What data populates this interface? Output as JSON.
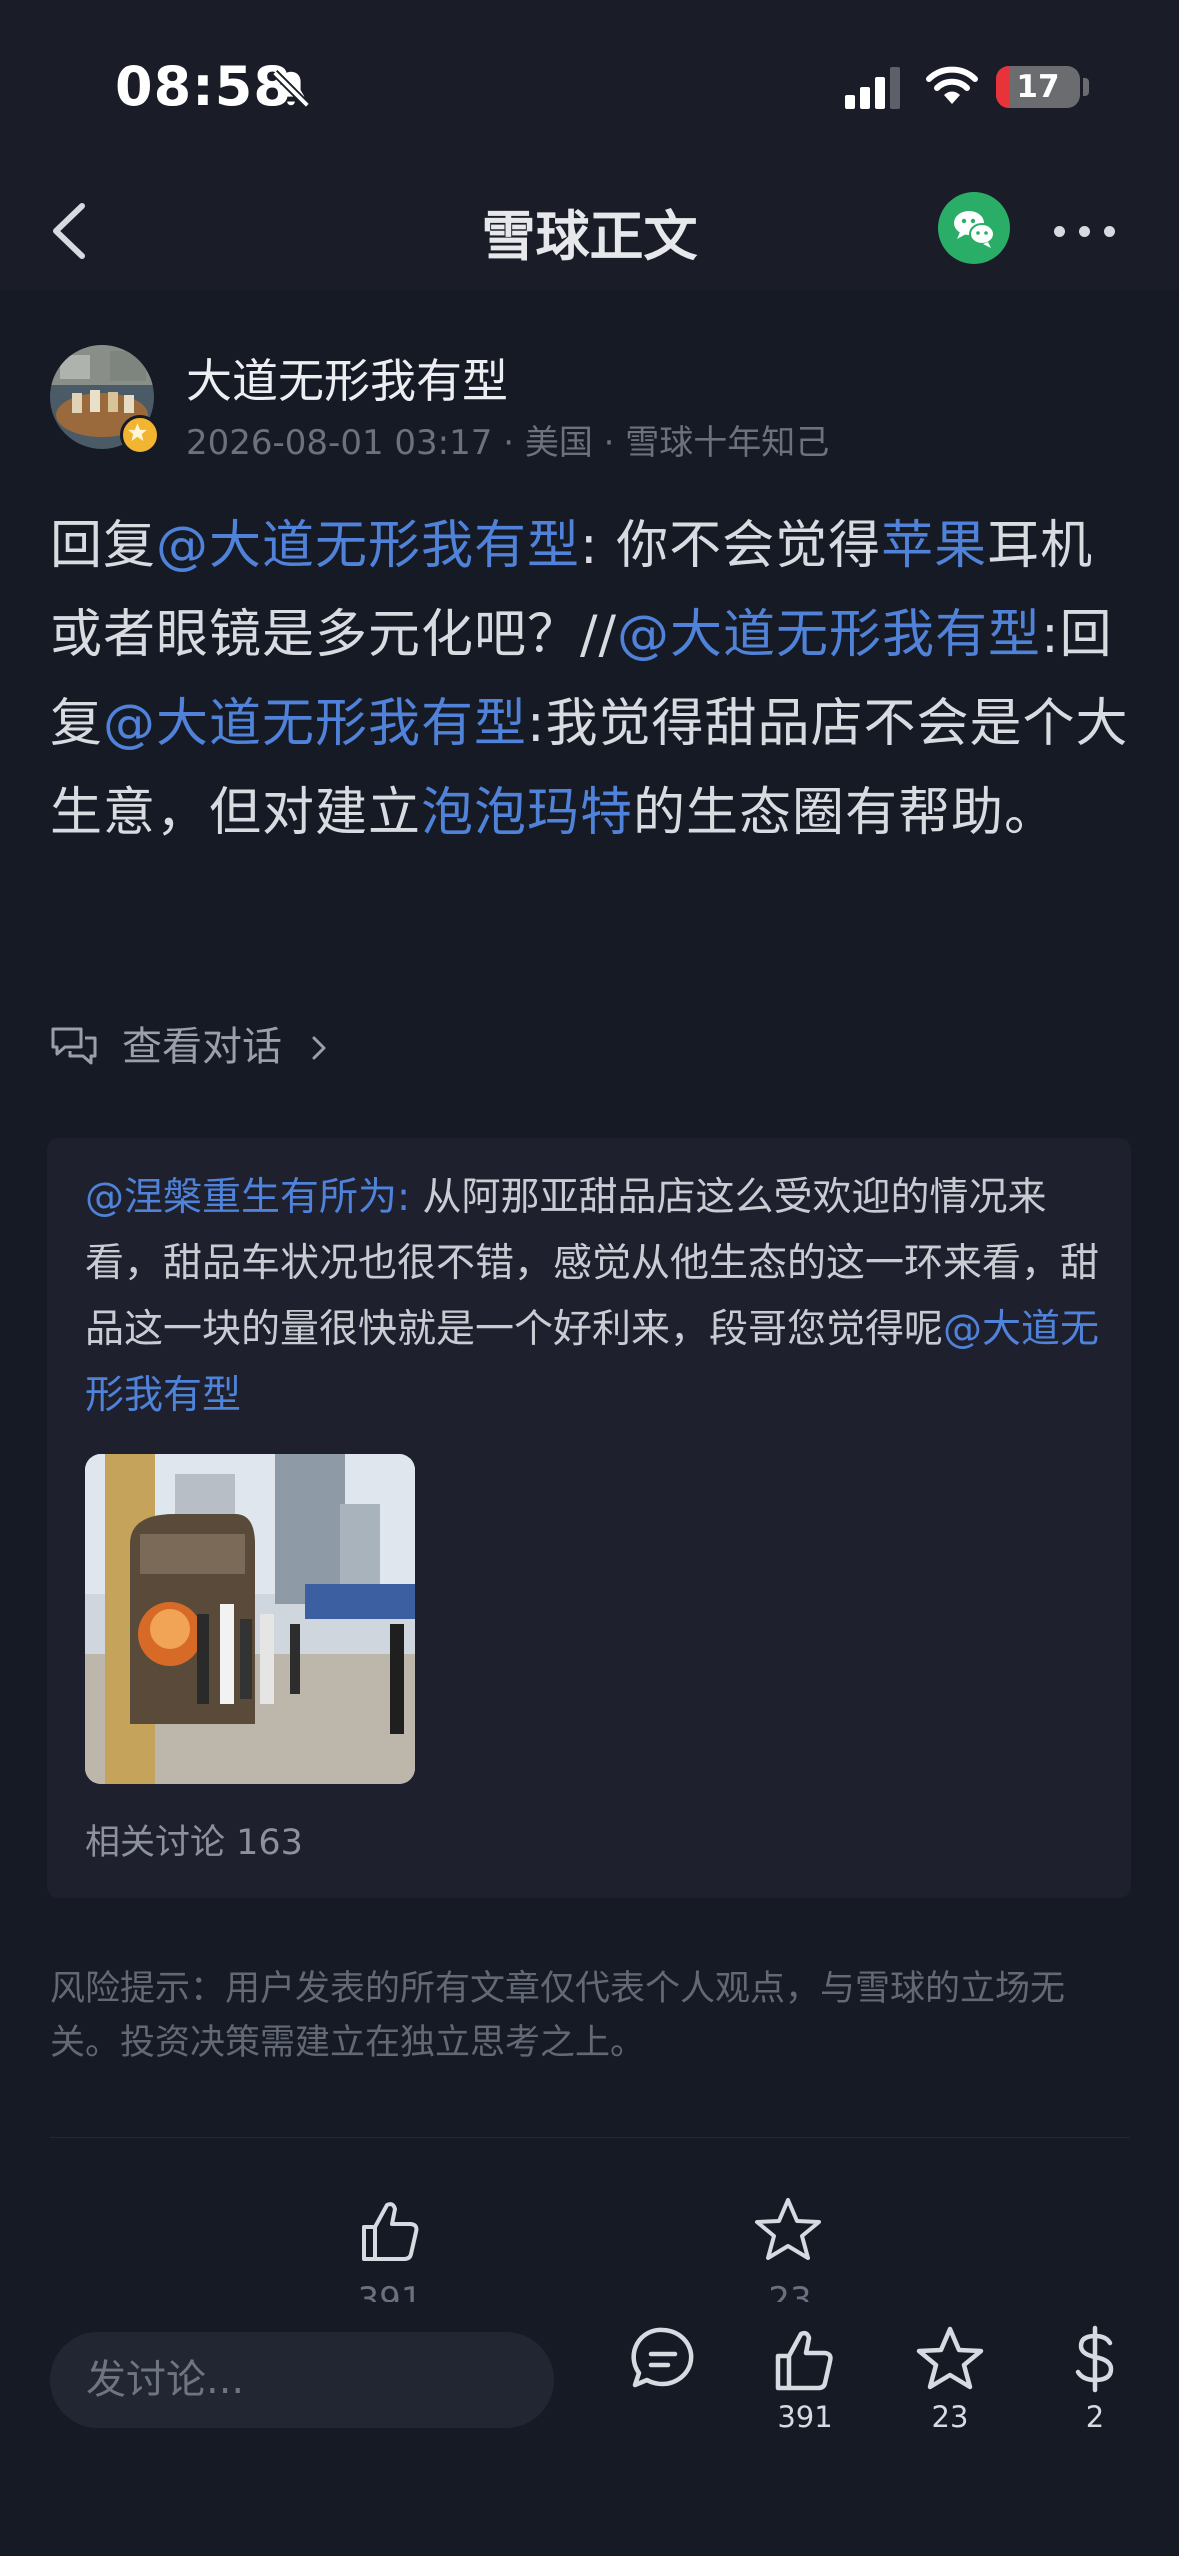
{
  "status_bar": {
    "time": "08:58",
    "battery": "17",
    "battery_level": 0.17
  },
  "nav": {
    "title": "雪球正文"
  },
  "author": {
    "name": "大道无形我有型",
    "date": "2026-08-01 03:17",
    "location": "美国",
    "tag": "雪球十年知己"
  },
  "post": {
    "segments": [
      {
        "text": "回复",
        "link": false
      },
      {
        "text": "@大道无形我有型",
        "link": true
      },
      {
        "text": ": 你不会觉得",
        "link": false
      },
      {
        "text": "苹果",
        "link": true
      },
      {
        "text": "耳机或者眼镜是多元化吧？//",
        "link": false
      },
      {
        "text": "@大道无形我有型",
        "link": true
      },
      {
        "text": ":回复",
        "link": false
      },
      {
        "text": "@大道无形我有型",
        "link": true
      },
      {
        "text": ":我觉得甜品店不会是个大生意，但对建立",
        "link": false
      },
      {
        "text": "泡泡玛特",
        "link": true
      },
      {
        "text": "的生态圈有帮助。",
        "link": false
      }
    ]
  },
  "thread": {
    "label": "查看对话"
  },
  "quote": {
    "author": "@涅槃重生有所为:",
    "text": " 从阿那亚甜品店这么受欢迎的情况来看，甜品车状况也很不错，感觉从他生态的这一环来看，甜品这一块的量很快就是一个好利来，段哥您觉得呢",
    "mention": "@大道无形我有型",
    "related": "相关讨论 163"
  },
  "risk_note": "风险提示：用户发表的所有文章仅代表个人观点，与雪球的立场无关。投资决策需建立在独立思考之上。",
  "actions": {
    "like_count": "391",
    "star_count": "23"
  },
  "bottom_bar": {
    "placeholder": "发讨论...",
    "like_count": "391",
    "star_count": "23",
    "reward_count": "2"
  },
  "colors": {
    "link": "#4f82d8",
    "background": "#161a24",
    "wechat": "#2aae67"
  }
}
